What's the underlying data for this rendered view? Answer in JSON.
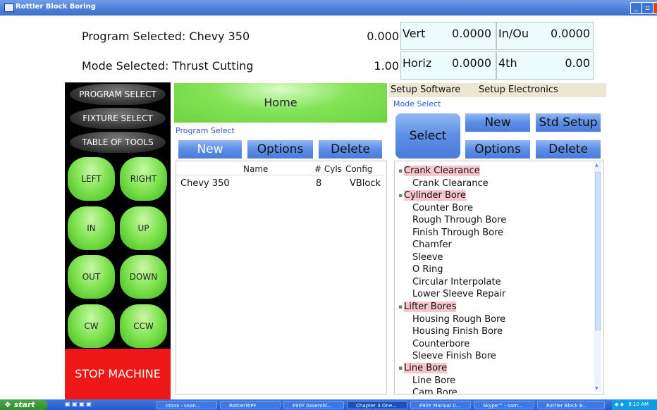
{
  "window": {
    "title": "Rottler Block Boring"
  },
  "header": {
    "program_label": "Program Selected: Chevy 350",
    "mode_label": "Mode Selected: Thrust Cutting",
    "value1": "0.000",
    "value2": "1.00",
    "vert_label": "Vert",
    "vert_value": "0.0000",
    "inout_label": "In/Ou",
    "inout_value": "0.0000",
    "horiz_label": "Horiz",
    "horiz_value": "0.0000",
    "fourth_label": "4th",
    "fourth_value": "0.00"
  },
  "left_panel": {
    "menu": [
      "PROGRAM SELECT",
      "FIXTURE SELECT",
      "TABLE OF TOOLS"
    ],
    "jog_buttons": [
      "LEFT",
      "RIGHT",
      "IN",
      "UP",
      "OUT",
      "DOWN",
      "CW",
      "CCW"
    ],
    "stop_label": "STOP MACHINE"
  },
  "home": {
    "label": "Home"
  },
  "program_select": {
    "section_label": "Program Select",
    "buttons": {
      "new": "New",
      "options": "Options",
      "delete": "Delete"
    },
    "columns": [
      "Name",
      "# Cyls",
      "Config"
    ],
    "rows": [
      {
        "name": "Chevy 350",
        "cyls": "8",
        "config": "VBlock"
      }
    ]
  },
  "setup": {
    "software": "Setup Software",
    "electronics": "Setup Electronics"
  },
  "mode_select": {
    "section_label": "Mode Select",
    "buttons": {
      "select": "Select",
      "new": "New",
      "std_setup": "Std Setup",
      "options": "Options",
      "delete": "Delete"
    },
    "tree": [
      {
        "group": "Crank Clearance",
        "items": [
          "Crank Clearance"
        ]
      },
      {
        "group": "Cylinder Bore",
        "items": [
          "Counter Bore",
          "Rough Through Bore",
          "Finish Through Bore",
          "Chamfer",
          "Sleeve",
          "O Ring",
          "Circular Interpolate",
          "Lower Sleeve Repair"
        ]
      },
      {
        "group": "Lifter Bores",
        "items": [
          "Housing Rough Bore",
          "Housing Finish Bore",
          "Counterbore",
          "Sleeve Finish Bore"
        ]
      },
      {
        "group": "Line Bore",
        "items": [
          "Line Bore",
          "Cam Bore"
        ]
      }
    ]
  },
  "taskbar": {
    "start": "start",
    "tasks": [
      "Inbox - sean...",
      "RottlerWPF",
      "F90Y Assembl...",
      "Chapter 3 One...",
      "F90Y Manual 0...",
      "Skype™ - sam...",
      "Rottler Block B..."
    ],
    "clock": "9:10 AM"
  },
  "colors": {
    "green": "#7de24e",
    "blue": "#5d8ee6",
    "stop_red": "#ee1818",
    "group_pink": "#f8c6cc",
    "section_blue": "#2b5bd7"
  }
}
